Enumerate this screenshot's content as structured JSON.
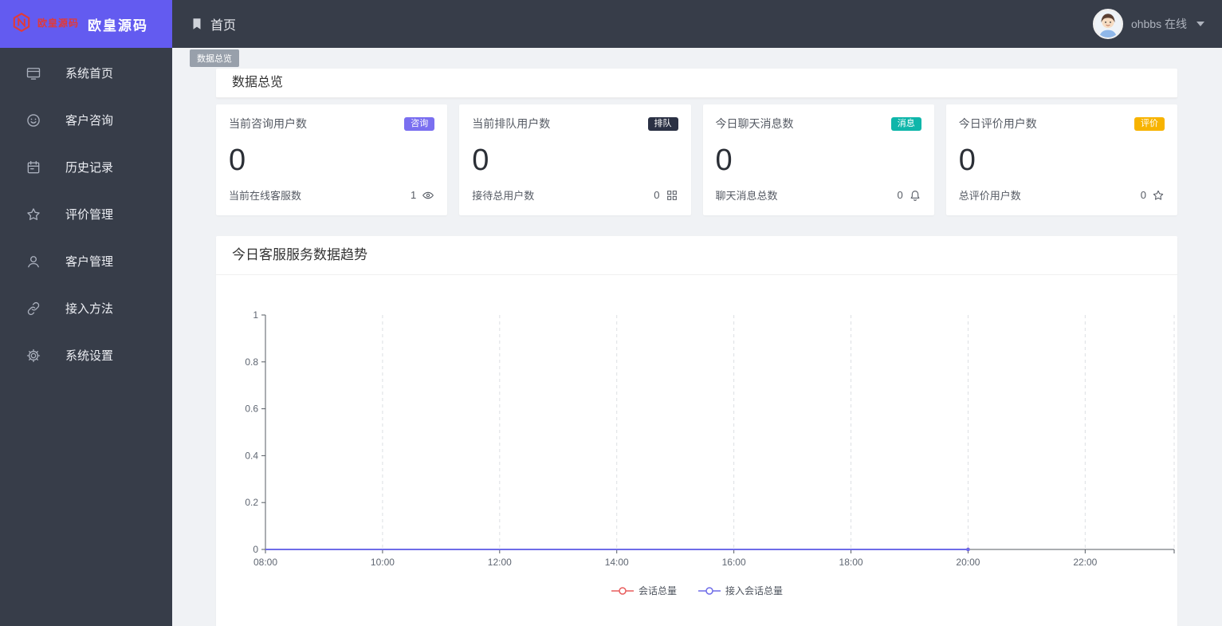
{
  "colors": {
    "topbar_bg": "#373d49",
    "sidebar_bg": "#373d49",
    "logo_bg": "#635bf0",
    "logo_mark_red": "#e03a3a"
  },
  "logo": {
    "mark": "欧皇源码",
    "brand": "欧皇源码"
  },
  "topbar": {
    "home": "首页",
    "username": "ohbbs",
    "status": "在线"
  },
  "tags": {
    "active": "数据总览"
  },
  "sidebar": {
    "items": [
      {
        "label": "系统首页",
        "icon": "monitor-icon"
      },
      {
        "label": "客户咨询",
        "icon": "chat-smile-icon"
      },
      {
        "label": "历史记录",
        "icon": "calendar-icon"
      },
      {
        "label": "评价管理",
        "icon": "star-icon"
      },
      {
        "label": "客户管理",
        "icon": "user-icon"
      },
      {
        "label": "接入方法",
        "icon": "link-icon"
      },
      {
        "label": "系统设置",
        "icon": "gear-icon"
      }
    ]
  },
  "overview": {
    "title": "数据总览",
    "cards": [
      {
        "title": "当前咨询用户数",
        "badge": "咨询",
        "badge_color": "#7a6ff0",
        "value": "0",
        "sub_label": "当前在线客服数",
        "sub_value": "1",
        "sub_icon": "eye-icon"
      },
      {
        "title": "当前排队用户数",
        "badge": "排队",
        "badge_color": "#2b3144",
        "value": "0",
        "sub_label": "接待总用户数",
        "sub_value": "0",
        "sub_icon": "grid-icon"
      },
      {
        "title": "今日聊天消息数",
        "badge": "消息",
        "badge_color": "#0fb6aa",
        "value": "0",
        "sub_label": "聊天消息总数",
        "sub_value": "0",
        "sub_icon": "bell-icon"
      },
      {
        "title": "今日评价用户数",
        "badge": "评价",
        "badge_color": "#f7b300",
        "value": "0",
        "sub_label": "总评价用户数",
        "sub_value": "0",
        "sub_icon": "star-icon"
      }
    ]
  },
  "chart_card": {
    "title": "今日客服服务数据趋势"
  },
  "chart_data": {
    "type": "line",
    "title": "今日客服服务数据趋势",
    "x": [
      "08:00",
      "10:00",
      "12:00",
      "14:00",
      "16:00",
      "18:00",
      "20:00",
      "22:00"
    ],
    "series": [
      {
        "name": "会话总量",
        "color": "#e85d5d",
        "values": [
          0,
          0,
          0,
          0,
          0,
          0,
          0,
          null
        ]
      },
      {
        "name": "接入会话总量",
        "color": "#6e6ce8",
        "values": [
          0,
          0,
          0,
          0,
          0,
          0,
          0,
          null
        ]
      }
    ],
    "ylim": [
      0,
      1
    ],
    "yticks": [
      0,
      0.2,
      0.4,
      0.6,
      0.8,
      1
    ],
    "grid": "vertical-dashed",
    "legend_position": "bottom"
  }
}
